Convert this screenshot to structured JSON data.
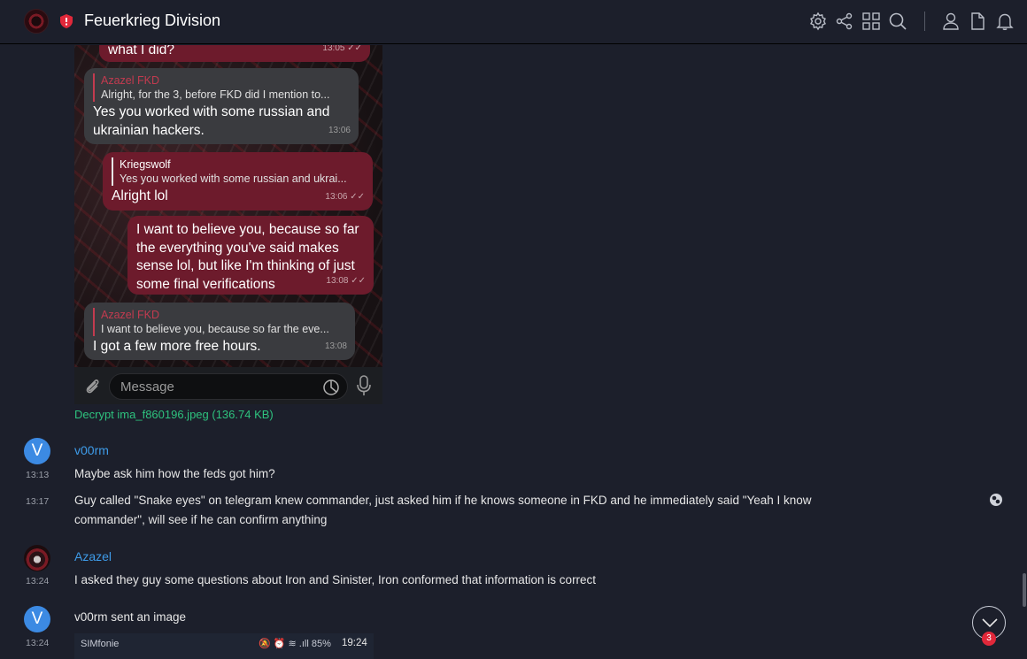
{
  "header": {
    "title": "Feuerkrieg Division",
    "icons": [
      "settings-icon",
      "share-icon",
      "grid-icon",
      "search-icon",
      "user-icon",
      "file-icon",
      "bell-icon"
    ]
  },
  "screenshot": {
    "messages": [
      {
        "text": "what I did?",
        "time": "13:05",
        "ticks": "✓✓"
      },
      {
        "reply_name": "Azazel FKD",
        "reply_text": "Alright, for the 3, before FKD did I mention to...",
        "text_lines": [
          "Yes you worked with some russian and",
          "ukrainian hackers."
        ],
        "time": "13:06"
      },
      {
        "reply_name": "Kriegswolf",
        "reply_text": "Yes you worked with some russian and ukrai...",
        "text": "Alright lol",
        "time": "13:06",
        "ticks": "✓✓"
      },
      {
        "text_lines": [
          "I want to believe you, because so far",
          "the everything you've said makes",
          "sense lol, but like I'm thinking of just",
          "some final verifications"
        ],
        "time": "13:08",
        "ticks": "✓✓"
      },
      {
        "reply_name": "Azazel FKD",
        "reply_text": "I want to believe you, because so far the eve...",
        "text": "I got a few more free hours.",
        "time": "13:08"
      }
    ],
    "composer_placeholder": "Message"
  },
  "attachment_link": "Decrypt ima_f860196.jpeg (136.74 KB)",
  "chat": [
    {
      "avatar_letter": "V",
      "name": "v00rm",
      "time": "13:13",
      "text": "Maybe ask him how the feds got him?"
    },
    {
      "time": "13:17",
      "text_lines": [
        "Guy called \"Snake eyes\" on telegram knew commander, just asked him if he knows someone in FKD and he immediately said \"Yeah I know",
        "commander\", will see if he can confirm anything"
      ]
    },
    {
      "name": "Azazel",
      "time": "13:24",
      "text": "I asked they guy some questions about Iron and Sinister, Iron conformed that information is correct"
    },
    {
      "avatar_letter": "V",
      "time": "13:24",
      "text": "v00rm sent an image"
    }
  ],
  "image_preview": {
    "carrier": "SIMfonie",
    "status_icons": "🔕 ⏰ ≋ .ıll 85%",
    "clock": "19:24"
  },
  "unread_count": "3"
}
